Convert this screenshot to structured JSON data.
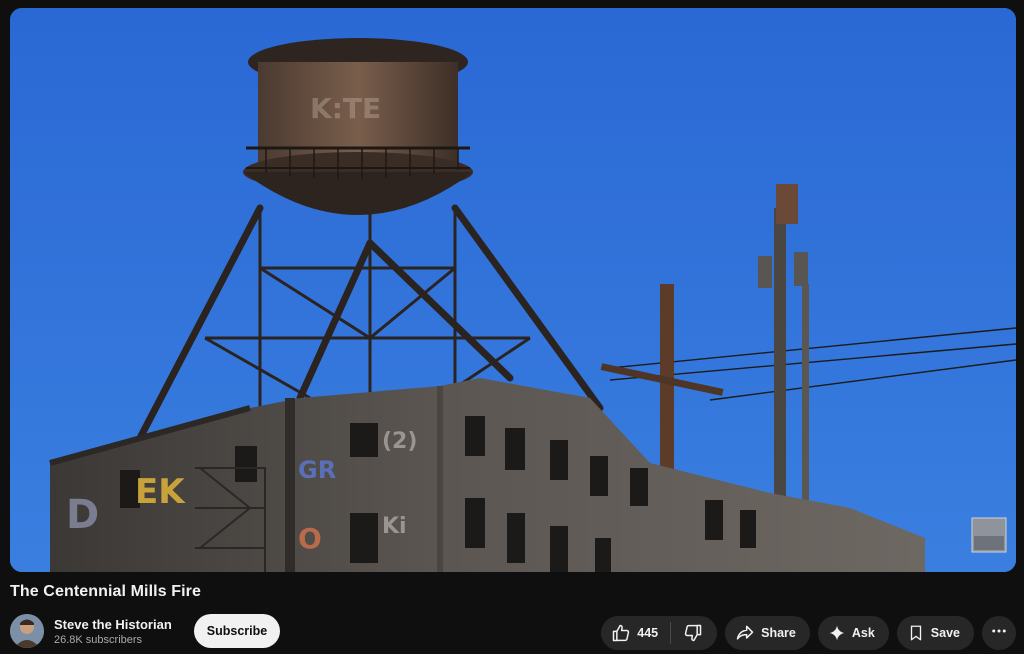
{
  "video": {
    "title": "The Centennial Mills Fire",
    "scene_description_icon": "water-tower-building-scene"
  },
  "channel": {
    "name": "Steve the Historian",
    "subscribers": "26.8K subscribers",
    "subscribe_label": "Subscribe"
  },
  "actions": {
    "like_count": "445",
    "share_label": "Share",
    "ask_label": "Ask",
    "save_label": "Save"
  },
  "colors": {
    "background": "#0f0f0f",
    "pill": "#272727",
    "sky": "#2d6fd6",
    "subscribe_bg": "#f1f1f1"
  }
}
